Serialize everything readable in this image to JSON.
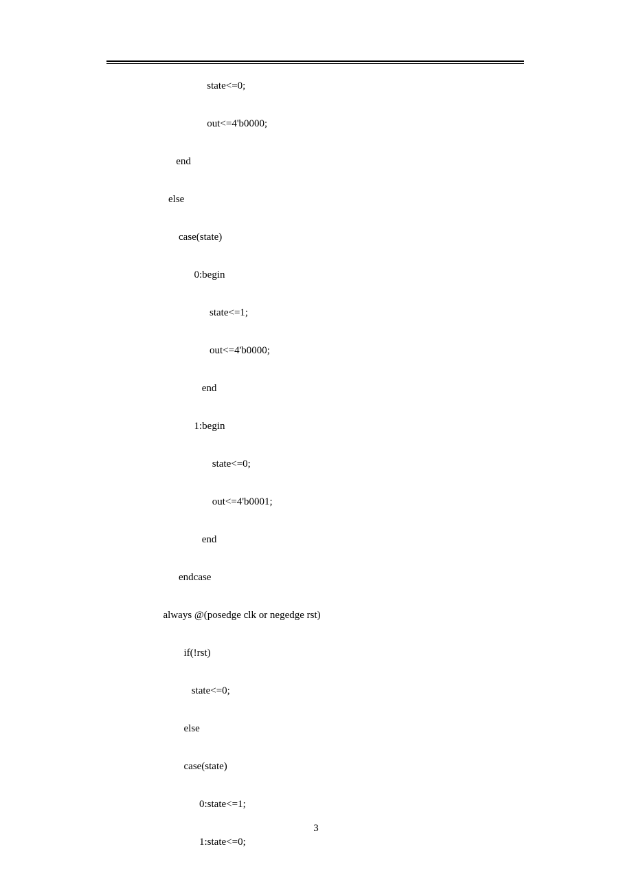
{
  "code_lines": [
    "                                       state<=0;",
    "                                       out<=4'b0000;",
    "                           end",
    "                        else",
    "                            case(state)",
    "                                  0:begin",
    "                                        state<=1;",
    "                                        out<=4'b0000;",
    "                                     end",
    "                                  1:begin",
    "                                         state<=0;",
    "                                         out<=4'b0001;",
    "                                     end",
    "                            endcase",
    "",
    "                      always @(posedge clk or negedge rst)",
    "                              if(!rst)",
    "                                 state<=0;",
    "                              else",
    "                              case(state)",
    "                                    0:state<=1;",
    "                                    1:state<=0;"
  ],
  "page_number": "3"
}
